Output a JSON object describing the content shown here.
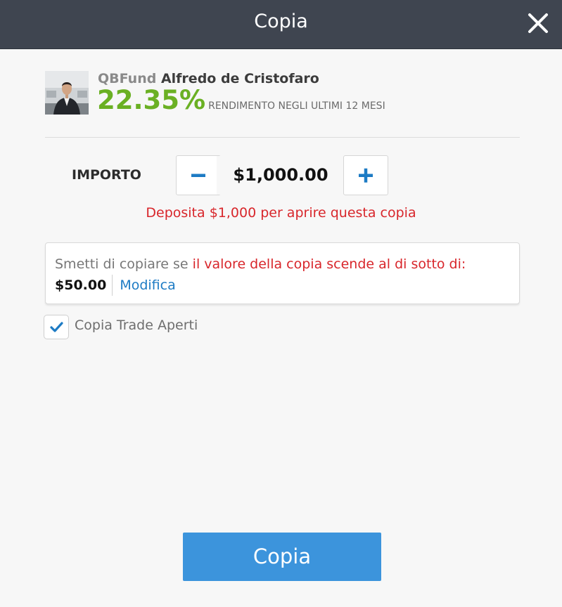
{
  "header": {
    "title": "Copia",
    "close_icon": "close-icon"
  },
  "trader": {
    "group": "QBFund",
    "name": "Alfredo de Cristofaro",
    "return_value": "22.35%",
    "return_label": "RENDIMENTO NEGLI ULTIMI 12 MESI",
    "return_color": "#6ab023"
  },
  "amount": {
    "label": "IMPORTO",
    "value": "$1,000.00",
    "minus_icon": "minus-icon",
    "plus_icon": "plus-icon",
    "accent_color": "#1d7bc4"
  },
  "deposit_message": "Deposita $1,000 per aprire questa copia",
  "stop_loss": {
    "prefix": "Smetti di copiare se ",
    "condition": "il valore della copia scende al di sotto di:",
    "amount": "$50.00",
    "edit_label": "Modifica"
  },
  "copy_open_trades": {
    "label": "Copia Trade Aperti",
    "checked": true,
    "check_icon": "checkmark-icon"
  },
  "submit": {
    "label": "Copia",
    "color": "#3c94dc"
  }
}
